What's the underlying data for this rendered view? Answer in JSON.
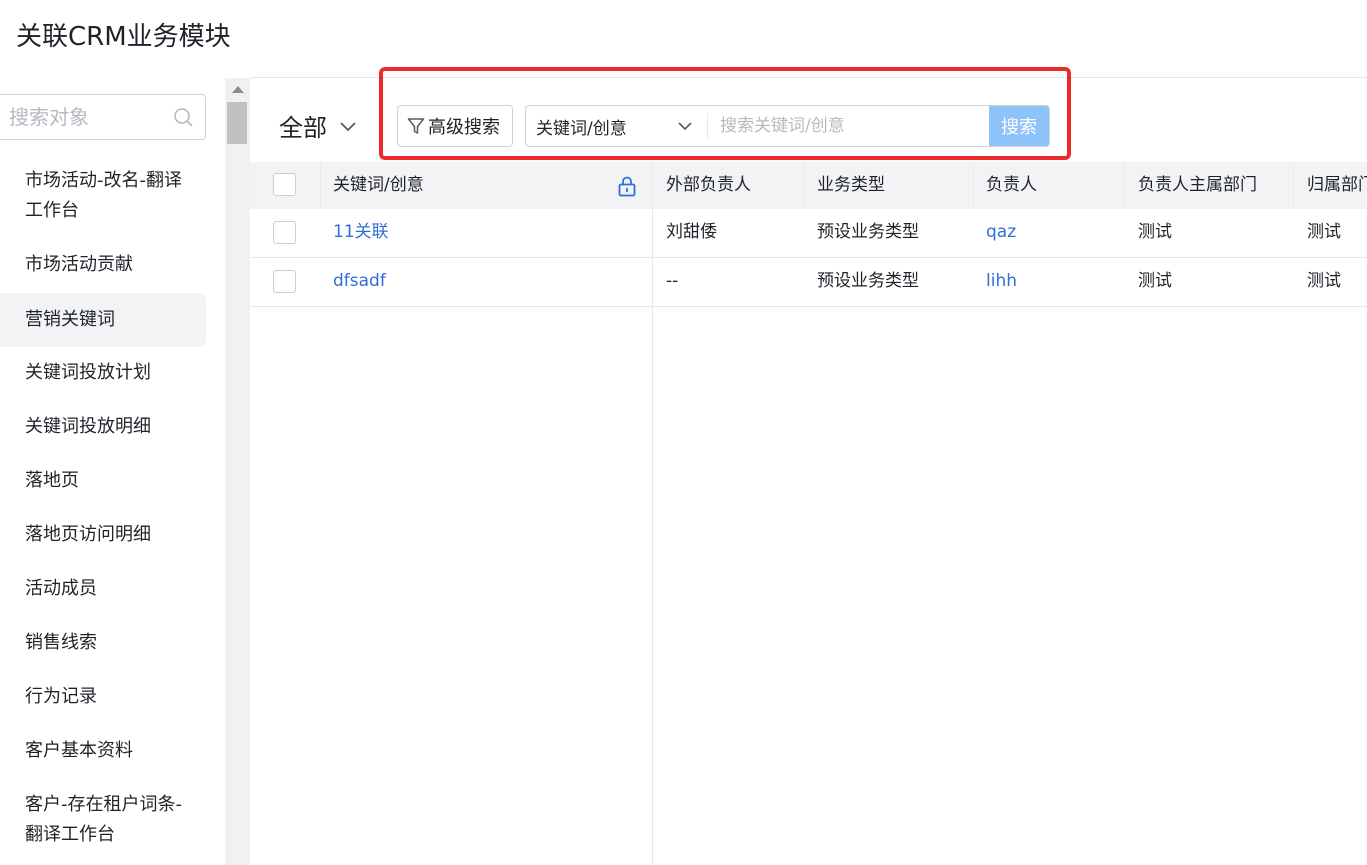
{
  "page": {
    "title": "关联CRM业务模块"
  },
  "sidebar": {
    "search_placeholder": "搜索对象",
    "items": [
      {
        "label": "市场活动-改名-翻译工作台",
        "active": false
      },
      {
        "label": "市场活动贡献",
        "active": false
      },
      {
        "label": "营销关键词",
        "active": true
      },
      {
        "label": "关键词投放计划",
        "active": false
      },
      {
        "label": "关键词投放明细",
        "active": false
      },
      {
        "label": "落地页",
        "active": false
      },
      {
        "label": "落地页访问明细",
        "active": false
      },
      {
        "label": "活动成员",
        "active": false
      },
      {
        "label": "销售线索",
        "active": false
      },
      {
        "label": "行为记录",
        "active": false
      },
      {
        "label": "客户基本资料",
        "active": false
      },
      {
        "label": "客户-存在租户词条-翻译工作台",
        "active": false
      }
    ]
  },
  "toolbar": {
    "view_label": "全部",
    "advanced_search_label": "高级搜索",
    "field_select_value": "关键词/创意",
    "search_placeholder": "搜索关键词/创意",
    "search_button": "搜索"
  },
  "table": {
    "columns": [
      "关键词/创意",
      "外部负责人",
      "业务类型",
      "负责人",
      "负责人主属部门",
      "归属部门"
    ],
    "rows": [
      {
        "keyword": "11关联",
        "external_owner": "刘甜倭",
        "biz_type": "预设业务类型",
        "owner": "qaz",
        "owner_dept": "测试",
        "dept": "测试"
      },
      {
        "keyword": "dfsadf",
        "external_owner": "--",
        "biz_type": "预设业务类型",
        "owner": "lihh",
        "owner_dept": "测试",
        "dept": "测试"
      }
    ]
  },
  "colors": {
    "highlight": "#ee2b2b",
    "link": "#2c6fd8",
    "search_button": "#8dc3f8",
    "header_bg": "#f2f3f5"
  }
}
